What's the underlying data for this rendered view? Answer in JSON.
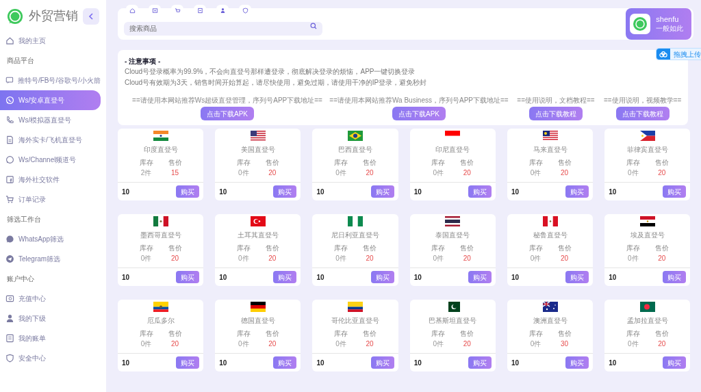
{
  "brand": {
    "title": "外贸营销"
  },
  "sidebar": {
    "items": [
      {
        "kind": "item",
        "label": "我的主页",
        "selected": false
      },
      {
        "kind": "section",
        "label": "商品平台"
      },
      {
        "kind": "item",
        "label": "推特号/FB号/谷歌号/小火箭",
        "selected": false
      },
      {
        "kind": "item",
        "label": "Ws/安卓直登号",
        "selected": true
      },
      {
        "kind": "item",
        "label": "Ws/模拟器直登号",
        "selected": false
      },
      {
        "kind": "item",
        "label": "海外实卡/飞机直登号",
        "selected": false
      },
      {
        "kind": "item",
        "label": "Ws/Channel频道号",
        "selected": false
      },
      {
        "kind": "item",
        "label": "海外社交软件",
        "selected": false
      },
      {
        "kind": "item",
        "label": "订单记录",
        "selected": false
      },
      {
        "kind": "section",
        "label": "筛选工作台"
      },
      {
        "kind": "item",
        "label": "WhatsApp筛选",
        "selected": false
      },
      {
        "kind": "item",
        "label": "Telegram筛选",
        "selected": false
      },
      {
        "kind": "section",
        "label": "账户中心"
      },
      {
        "kind": "item",
        "label": "充值中心",
        "selected": false
      },
      {
        "kind": "item",
        "label": "我的下级",
        "selected": false
      },
      {
        "kind": "item",
        "label": "我的账单",
        "selected": false
      },
      {
        "kind": "item",
        "label": "安全中心",
        "selected": false
      }
    ]
  },
  "search": {
    "placeholder": "搜索商品"
  },
  "user": {
    "name": "shenfu",
    "subtitle": "一般如此"
  },
  "upload": {
    "label": "拖拽上传"
  },
  "notice": {
    "title": "- 注意事项 -",
    "lines": [
      "Cloud号登录概率为99.9%，不会向直登号那样遭登录，彻底解决登录的烦恼，APP一键切换登录",
      "Cloud号有效期为3天，销售时间开始算起，请尽快使用，避免过期，请使用干净的IP登录，避免秒封"
    ],
    "downloads": [
      {
        "text": "==请使用本网站推荐Ws超级直登管理，序列号APP下载地址==",
        "button": "点击下载APK"
      },
      {
        "text": "==请使用本网站推荐Wa Business，序列号APP下载地址==",
        "button": "点击下载APK"
      },
      {
        "text": "==使用说明，文档教程==",
        "button": "点击下载教程"
      },
      {
        "text": "==使用说明，视频教学==",
        "button": "点击下载教程"
      }
    ]
  },
  "products": [
    {
      "kind": "in",
      "name": "印度直登号",
      "stock_label": "库存",
      "price_label": "售价",
      "stock": "2件",
      "price": "15",
      "qty": "10",
      "button": "购买"
    },
    {
      "kind": "us",
      "name": "美国直登号",
      "stock_label": "库存",
      "price_label": "售价",
      "stock": "0件",
      "price": "20",
      "qty": "10",
      "button": "购买"
    },
    {
      "kind": "br",
      "name": "巴西直登号",
      "stock_label": "库存",
      "price_label": "售价",
      "stock": "0件",
      "price": "20",
      "qty": "10",
      "button": "购买"
    },
    {
      "kind": "id",
      "name": "印尼直登号",
      "stock_label": "库存",
      "price_label": "售价",
      "stock": "0件",
      "price": "20",
      "qty": "10",
      "button": "购买"
    },
    {
      "kind": "my",
      "name": "马来直登号",
      "stock_label": "库存",
      "price_label": "售价",
      "stock": "0件",
      "price": "20",
      "qty": "10",
      "button": "购买"
    },
    {
      "kind": "ph",
      "name": "菲律宾直登号",
      "stock_label": "库存",
      "price_label": "售价",
      "stock": "0件",
      "price": "20",
      "qty": "10",
      "button": "购买"
    },
    {
      "kind": "mx",
      "name": "墨西哥直登号",
      "stock_label": "库存",
      "price_label": "售价",
      "stock": "0件",
      "price": "20",
      "qty": "10",
      "button": "购买"
    },
    {
      "kind": "tr",
      "name": "土耳其直登号",
      "stock_label": "库存",
      "price_label": "售价",
      "stock": "0件",
      "price": "20",
      "qty": "10",
      "button": "购买"
    },
    {
      "kind": "ng",
      "name": "尼日利亚直登号",
      "stock_label": "库存",
      "price_label": "售价",
      "stock": "0件",
      "price": "20",
      "qty": "10",
      "button": "购买"
    },
    {
      "kind": "th",
      "name": "泰国直登号",
      "stock_label": "库存",
      "price_label": "售价",
      "stock": "0件",
      "price": "20",
      "qty": "10",
      "button": "购买"
    },
    {
      "kind": "pe",
      "name": "秘鲁直登号",
      "stock_label": "库存",
      "price_label": "售价",
      "stock": "0件",
      "price": "20",
      "qty": "10",
      "button": "购买"
    },
    {
      "kind": "eg",
      "name": "埃及直登号",
      "stock_label": "库存",
      "price_label": "售价",
      "stock": "0件",
      "price": "20",
      "qty": "10",
      "button": "购买"
    },
    {
      "kind": "ec",
      "name": "厄瓜多尔",
      "stock_label": "库存",
      "price_label": "售价",
      "stock": "0件",
      "price": "20",
      "qty": "10",
      "button": "购买"
    },
    {
      "kind": "de",
      "name": "德国直登号",
      "stock_label": "库存",
      "price_label": "售价",
      "stock": "0件",
      "price": "20",
      "qty": "10",
      "button": "购买"
    },
    {
      "kind": "co",
      "name": "哥伦比亚直登号",
      "stock_label": "库存",
      "price_label": "售价",
      "stock": "0件",
      "price": "20",
      "qty": "10",
      "button": "购买"
    },
    {
      "kind": "pk",
      "name": "巴基斯坦直登号",
      "stock_label": "库存",
      "price_label": "售价",
      "stock": "0件",
      "price": "20",
      "qty": "10",
      "button": "购买"
    },
    {
      "kind": "au",
      "name": "澳洲直登号",
      "stock_label": "库存",
      "price_label": "售价",
      "stock": "0件",
      "price": "30",
      "qty": "10",
      "button": "购买"
    },
    {
      "kind": "bd",
      "name": "孟加拉直登号",
      "stock_label": "库存",
      "price_label": "售价",
      "stock": "0件",
      "price": "20",
      "qty": "10",
      "button": "购买"
    }
  ]
}
